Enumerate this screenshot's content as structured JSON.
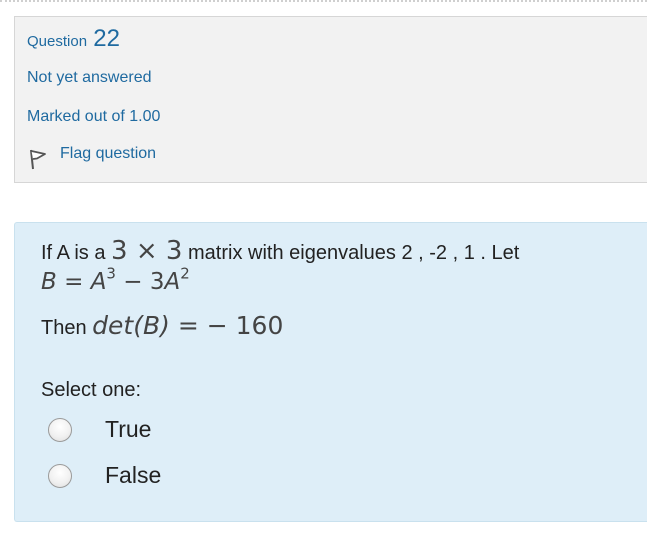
{
  "question": {
    "title_prefix": "Question",
    "number": "22",
    "status": "Not yet answered",
    "marks": "Marked out of 1.00",
    "flag_label": "Flag question"
  },
  "prompt": {
    "intro": "If A is a",
    "matrix_size": "3 × 3",
    "middle": "matrix with eigenvalues 2 , -2 , 1 . Let",
    "formula": {
      "lhs": "B",
      "eq": "=",
      "term1_base": "A",
      "term1_exp": "3",
      "minus": "−",
      "term2_coef": "3",
      "term2_base": "A",
      "term2_exp": "2"
    },
    "then_text": "Then",
    "det_expr": "det(B)",
    "det_eq": "=",
    "det_value": "− 160"
  },
  "answer": {
    "select_label": "Select one:",
    "options": [
      {
        "label": "True",
        "selected": false
      },
      {
        "label": "False",
        "selected": false
      }
    ]
  },
  "colors": {
    "link_blue": "#1f6aa0",
    "info_bg": "#f2f2f2",
    "question_bg": "#deeef8"
  },
  "icons": {
    "flag": "flag-icon",
    "radio": "radio-icon"
  }
}
